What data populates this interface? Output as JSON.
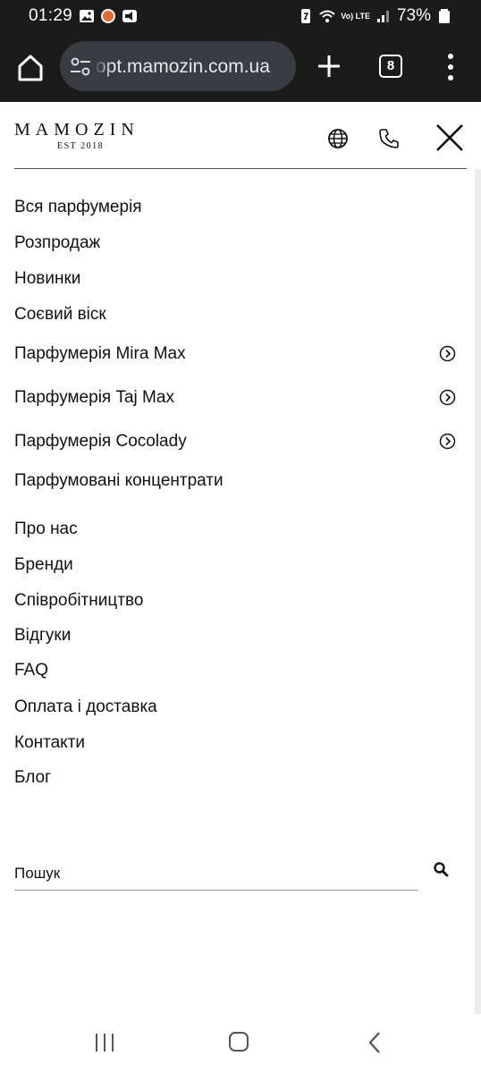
{
  "status_bar": {
    "time": "01:29",
    "battery": "73%",
    "network": "Vo) LTE"
  },
  "browser": {
    "url": "opt.mamozin.com.ua",
    "tab_count": "8"
  },
  "site": {
    "logo": "MAMOZIN",
    "logo_sub": "EST 2018"
  },
  "menu": {
    "items": [
      {
        "label": "Вся парфумерія",
        "has_arrow": false
      },
      {
        "label": "Розпродаж",
        "has_arrow": false
      },
      {
        "label": "Новинки",
        "has_arrow": false
      },
      {
        "label": "Соєвий віск",
        "has_arrow": false
      },
      {
        "label": "Парфумерія Mira Max",
        "has_arrow": true
      },
      {
        "label": "Парфумерія Taj Max",
        "has_arrow": true
      },
      {
        "label": "Парфумерія Cocolady",
        "has_arrow": true
      },
      {
        "label": "Парфумовані концентрати",
        "has_arrow": false
      },
      {
        "label": "Про нас",
        "has_arrow": false
      },
      {
        "label": "Бренди",
        "has_arrow": false
      },
      {
        "label": "Співробітництво",
        "has_arrow": false
      },
      {
        "label": "Відгуки",
        "has_arrow": false
      },
      {
        "label": "FAQ",
        "has_arrow": false
      },
      {
        "label": "Оплата і доставка",
        "has_arrow": false
      },
      {
        "label": "Контакти",
        "has_arrow": false
      },
      {
        "label": "Блог",
        "has_arrow": false
      }
    ]
  },
  "search": {
    "placeholder": "Пошук"
  },
  "icons": {
    "home": "home-icon",
    "site_settings": "tune-icon",
    "new_tab": "plus-icon",
    "tabs": "tab-switcher-icon",
    "overflow": "more-vert-icon",
    "language": "globe-icon",
    "phone": "phone-icon",
    "close": "close-icon",
    "submenu": "circle-chevron-right-icon",
    "search": "search-icon"
  }
}
